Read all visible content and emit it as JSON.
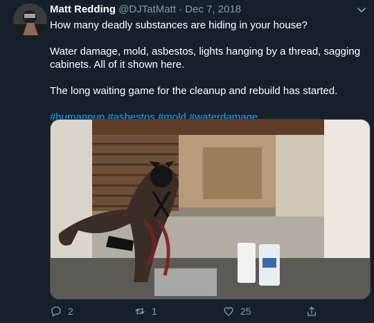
{
  "tweet": {
    "display_name": "Matt Redding",
    "handle": "@DJTatMatt",
    "separator": "·",
    "date": "Dec 7, 2018",
    "line1": "How many deadly substances are hiding in your house?",
    "line2": "Water damage, mold, asbestos, lights hanging by a thread, sagging cabinets. All of it shown here.",
    "line3": "The long waiting game for the cleanup and rebuild has started.",
    "hashtags": [
      "#humanpup",
      "#asbestos",
      "#mold",
      "#waterdamage"
    ]
  },
  "actions": {
    "replies": "2",
    "retweets": "1",
    "likes": "25"
  },
  "icons": {
    "reply": "reply-icon",
    "retweet": "retweet-icon",
    "like": "heart-icon",
    "share": "share-icon",
    "more": "chevron-down-icon"
  },
  "colors": {
    "background": "#15202b",
    "link": "#1da1f2",
    "muted": "#8899a6"
  }
}
